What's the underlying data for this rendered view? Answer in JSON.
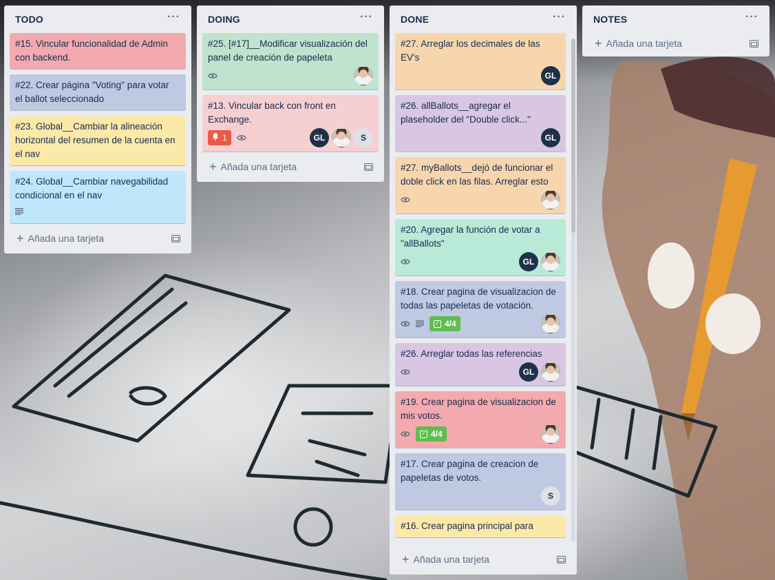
{
  "colors": {
    "list_bg": "#ebecf0",
    "text": "#172b4d",
    "muted": "#5e6c84",
    "notification_badge": "#eb5a46",
    "checklist_badge": "#61bd4f",
    "avatar_gl": "#1f3148"
  },
  "lists": {
    "todo": {
      "title": "TODO",
      "menu_icon": "ellipsis-icon",
      "add_label": "Añada una tarjeta",
      "cards": [
        {
          "title": "#15. Vincular funcionalidad de Admin con backend.",
          "color": "red"
        },
        {
          "title": "#22. Crear página \"Voting\" para votar el ballot seleccionado",
          "color": "blue"
        },
        {
          "title": "#23. Global__Cambiar la alineación horizontal del resumen de la cuenta en el nav",
          "color": "yellow"
        },
        {
          "title": "#24. Global__Cambiar navegabilidad condicional en el nav",
          "color": "sky",
          "badges": [
            "description-icon"
          ]
        }
      ]
    },
    "doing": {
      "title": "DOING",
      "add_label": "Añada una tarjeta",
      "cards": [
        {
          "title": "#25. [#17]__Modificar visualización del panel de creación de papeleta",
          "color": "green",
          "badges": [
            "watch-icon"
          ],
          "members": [
            "photo"
          ]
        },
        {
          "title": "#13. Vincular back con front en Exchange.",
          "color": "pink",
          "notification_count": "1",
          "badges": [
            "watch-icon"
          ],
          "members": [
            "GL",
            "photo",
            "S"
          ]
        }
      ]
    },
    "done": {
      "title": "DONE",
      "add_label": "Añada una tarjeta",
      "cards": [
        {
          "title": "#27. Arreglar los decimales de las EV's",
          "color": "orange",
          "members": [
            "GL"
          ]
        },
        {
          "title": "#26. allBallots__agregar el plaseholder del \"Double click...\"",
          "color": "purple",
          "members": [
            "GL"
          ]
        },
        {
          "title": "#27. myBallots__dejó de funcionar el doble click en las filas. Arreglar esto",
          "color": "orange",
          "badges": [
            "watch-icon"
          ],
          "members": [
            "photo"
          ]
        },
        {
          "title": "#20. Agregar la función de votar a \"allBallots\"",
          "color": "teal",
          "badges": [
            "watch-icon"
          ],
          "members": [
            "GL",
            "photo"
          ]
        },
        {
          "title": "#18. Crear pagina de visualizacion de todas las papeletas de votación.",
          "color": "blue",
          "badges": [
            "watch-icon",
            "description-icon"
          ],
          "checklist": "4/4",
          "members": [
            "photo"
          ]
        },
        {
          "title": "#26. Arreglar todas las referencias",
          "color": "purple",
          "badges": [
            "watch-icon"
          ],
          "members": [
            "GL",
            "photo"
          ]
        },
        {
          "title": "#19. Crear pagina de visualizacion de mis votos.",
          "color": "red",
          "badges": [
            "watch-icon"
          ],
          "checklist": "4/4",
          "members": [
            "photo"
          ]
        },
        {
          "title": "#17. Crear pagina de creacion de papeletas de votos.",
          "color": "blue",
          "members": [
            "S"
          ]
        },
        {
          "title": "#16. Crear pagina principal para",
          "color": "yellow"
        }
      ]
    },
    "notes": {
      "title": "NOTES",
      "add_label": "Añada una tarjeta",
      "cards": []
    }
  }
}
